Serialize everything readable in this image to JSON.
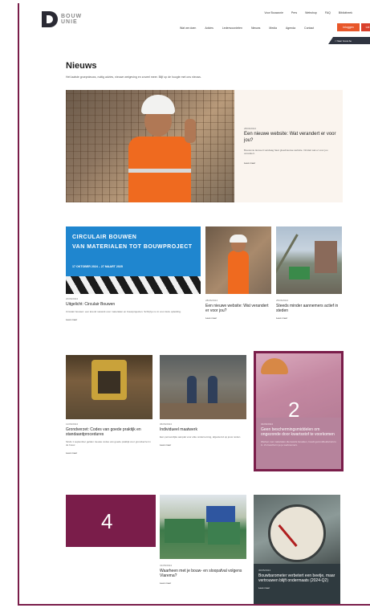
{
  "header": {
    "logo_text_1": "BOUW",
    "logo_text_2": "UNIE",
    "top_links": [
      "Voor Bouwunie",
      "Pers",
      "Webshop",
      "FAQ",
      "Bibliotheek"
    ],
    "nav_items": [
      "Wat we doen",
      "Advies",
      "Ledenvoordelen",
      "Nieuws",
      "Media",
      "Agenda",
      "Contact"
    ],
    "login_label": "Inloggen",
    "member_label": "Lid",
    "ribbon_label": "< Naar bouw.be"
  },
  "page": {
    "title": "Nieuws",
    "intro": "Het laatste groepnieuws, nuttig advies, nieuwe wetgeving en zoveel meer. Blijf op de hoogte met ons nieuws."
  },
  "hero": {
    "date": "28/06/2024",
    "title": "Een nieuwe website: Wat verandert er voor jou?",
    "description": "Bouwunie lanceert vandaag haar gloednieuwe website. Ontdek wat er voor jou verandert.",
    "read_more": "Lees meer"
  },
  "cards_row1": [
    {
      "banner_line1": "CIRCULAIR BOUWEN",
      "banner_line2": "VAN MATERIALEN TOT BOUWPROJECT",
      "banner_line3": "17 OKTOBER 2024 – 27 MAART 2025",
      "date": "20/06/2024",
      "title": "Uitgelicht: Circulair Bouwen",
      "description": "Circulair bouwen: een lerend netwerk over materialen en bouwprojecten. Schrijf je nu in voor deze opleiding.",
      "read_more": "Lees meer"
    },
    {
      "date": "28/06/2024",
      "title": "Een nieuwe website: Wat verandert er voor jou?",
      "read_more": "Lees meer"
    },
    {
      "date": "25/06/2024",
      "title": "Steeds minder aannemers actief in steden",
      "read_more": "Lees meer"
    }
  ],
  "cards_row2": [
    {
      "date": "12/06/2024",
      "title": "Grondverzet: Codes van goede praktijk en standaardprocedures",
      "description": "Sinds 1 september gelden nieuwe codes van goede praktijk voor grondverzet in de bouw.",
      "read_more": "Lees meer"
    },
    {
      "date": "06/06/2024",
      "title": "Individueel maatwerk",
      "description": "Een persoonlijke aanpak voor elke onderneming, afgestemd op jouw noden.",
      "read_more": "Lees meer"
    }
  ],
  "marker2": {
    "number": "2",
    "date": "04/06/2024",
    "title": "Geen beschermingsmiddelen om ongezonde door kwartsstof te voorkomen",
    "description": "Werken met materialen die kwarts bevatten, houdt gezondheidsrisico's in. Zo bescherm je je werknemers."
  },
  "cards_row3": [
    {
      "date": "31/05/2024",
      "title": "Waarheen met je bouw- en sloopafval volgens Vlarema?",
      "read_more": "Lees meer"
    },
    {
      "date": "30/05/2024",
      "title": "Bouwbarometer verbetert een beetje, maar vertrouwen blijft ondermaats (2024-Q2)",
      "read_more": "Lees meer"
    }
  ],
  "marker4": {
    "number": "4"
  }
}
